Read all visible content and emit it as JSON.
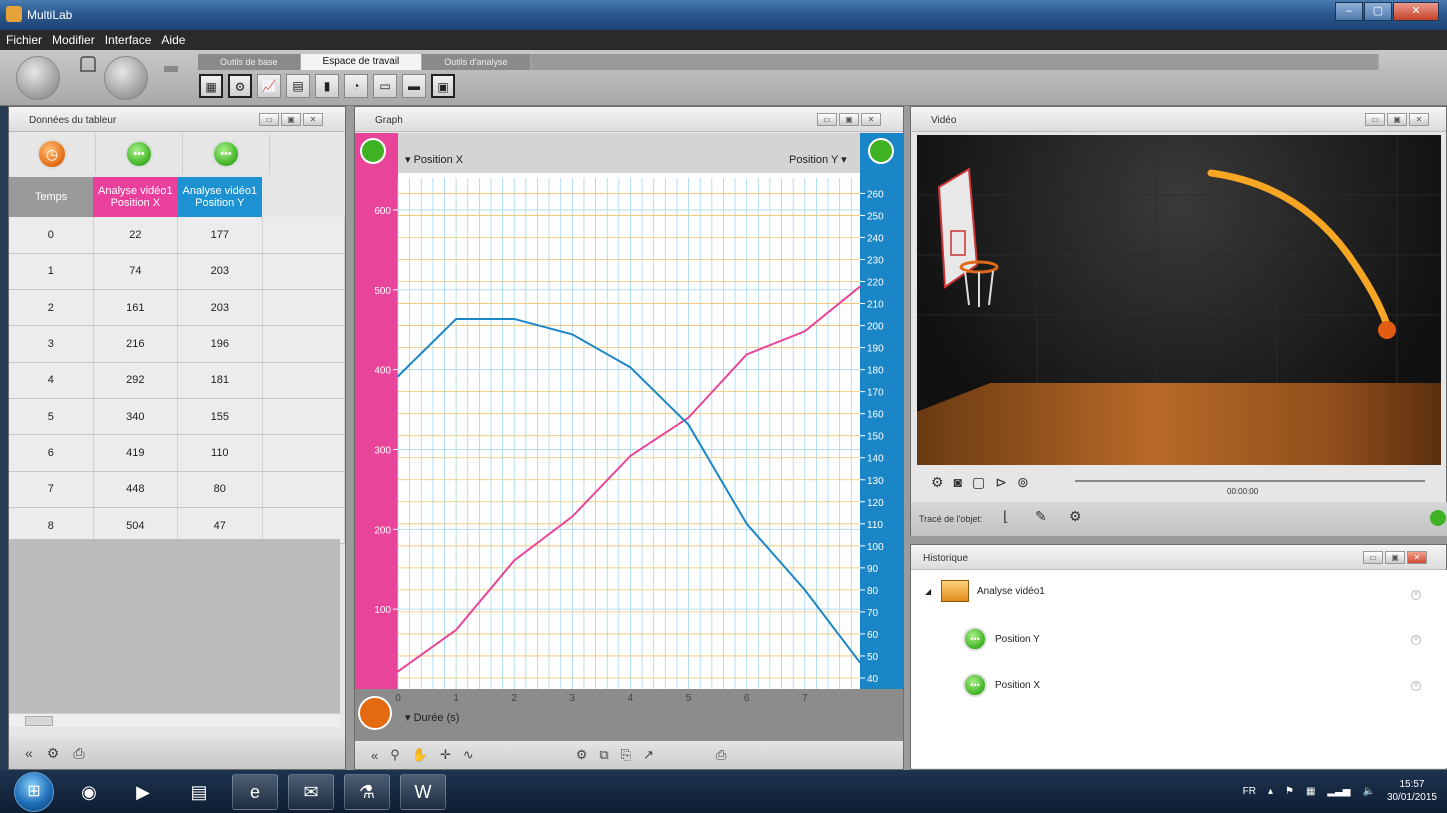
{
  "window": {
    "title": "MultiLab",
    "minimize": "–",
    "maximize": "▢",
    "close": "✕"
  },
  "menu": [
    "Fichier",
    "Modifier",
    "Interface",
    "Aide"
  ],
  "ribbon": {
    "tabs": [
      "Outils de base",
      "Espace de travail",
      "Outils d'analyse"
    ],
    "active_tab": "Espace de travail"
  },
  "table_panel": {
    "title": "Données du tableur",
    "headers": [
      "Temps",
      "Analyse vidéo1\nPosition X",
      "Analyse vidéo1\nPosition Y"
    ],
    "rows": [
      [
        "0",
        "22",
        "177"
      ],
      [
        "1",
        "74",
        "203"
      ],
      [
        "2",
        "161",
        "203"
      ],
      [
        "3",
        "216",
        "196"
      ],
      [
        "4",
        "292",
        "181"
      ],
      [
        "5",
        "340",
        "155"
      ],
      [
        "6",
        "419",
        "110"
      ],
      [
        "7",
        "448",
        "80"
      ],
      [
        "8",
        "504",
        "47"
      ]
    ]
  },
  "graph_panel": {
    "title": "Graph",
    "x_selector": "▾ Durée (s)",
    "left_selector": "▾ Position X",
    "right_selector": "Position Y ▾"
  },
  "chart_data": {
    "type": "line",
    "x": [
      0,
      1,
      2,
      3,
      4,
      5,
      6,
      7,
      8
    ],
    "xlabel": "Durée (s)",
    "x_ticks": [
      0,
      1,
      2,
      3,
      4,
      5,
      6,
      7
    ],
    "xlim": [
      0,
      7.95
    ],
    "series": [
      {
        "name": "Position X",
        "axis": "left",
        "color": "#e8459a",
        "values": [
          22,
          74,
          161,
          216,
          292,
          340,
          419,
          448,
          504
        ]
      },
      {
        "name": "Position Y",
        "axis": "right",
        "color": "#1b86c7",
        "values": [
          177,
          203,
          203,
          196,
          181,
          155,
          110,
          80,
          47
        ]
      }
    ],
    "left_axis": {
      "label": "Position X",
      "ylim": [
        0,
        640
      ],
      "ticks": [
        100,
        200,
        300,
        400,
        500,
        600
      ]
    },
    "right_axis": {
      "label": "Position Y",
      "ylim": [
        35,
        267
      ],
      "ticks": [
        40,
        50,
        60,
        70,
        80,
        90,
        100,
        110,
        120,
        130,
        140,
        150,
        160,
        170,
        180,
        190,
        200,
        210,
        220,
        230,
        240,
        250,
        260
      ]
    },
    "grid": true,
    "colors": {
      "left_axis_bg": "#e8459a",
      "right_axis_bg": "#1b86c7",
      "grid_v": "#9fd6ee",
      "grid_h": "#f0c36a"
    }
  },
  "video_panel": {
    "title": "Vidéo",
    "timecode": "00:00:00",
    "trace_label": "Tracé de l'objet:"
  },
  "history_panel": {
    "title": "Historique",
    "root": "Analyse vidéo1",
    "children": [
      "Position Y",
      "Position X"
    ]
  },
  "taskbar": {
    "language": "FR",
    "time": "15:57",
    "date": "30/01/2015"
  },
  "colors": {
    "pink": "#ea3f9d",
    "blue": "#1c92d2",
    "orange": "#e36a10",
    "green": "#3eb223"
  }
}
